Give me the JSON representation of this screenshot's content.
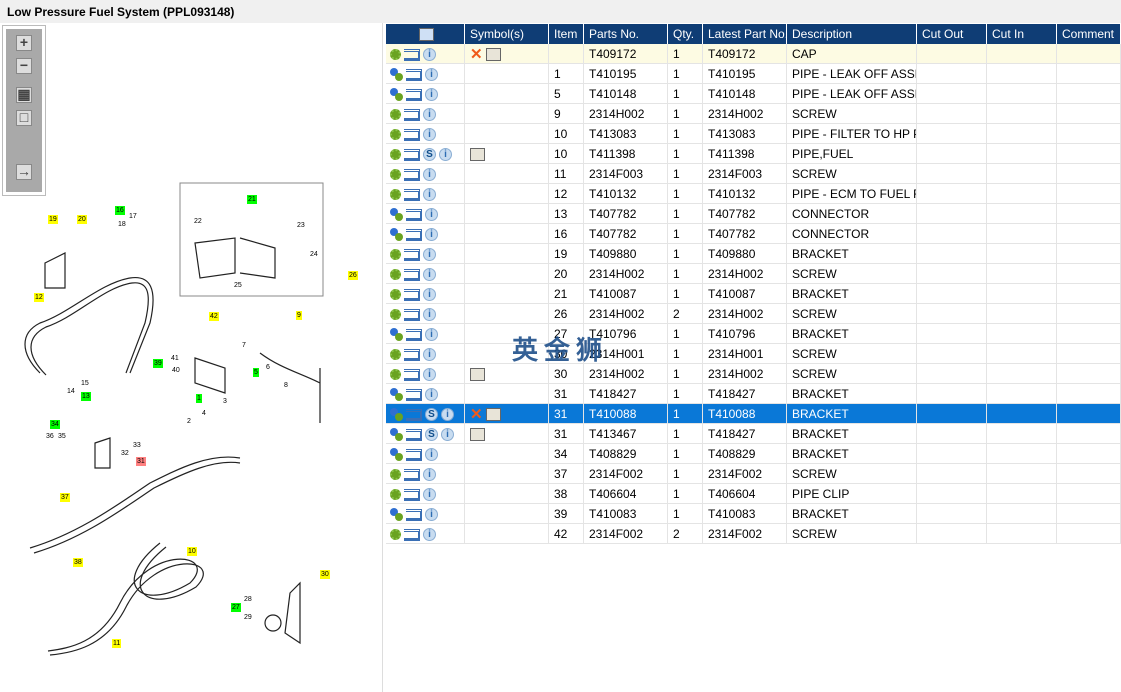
{
  "window_title": "Low Pressure Fuel System (PPL093148)",
  "toolbar": [
    "zoom-in",
    "zoom-out",
    "fit-all",
    "actual-size",
    "export"
  ],
  "watermark": "英金狮",
  "colors": {
    "header": "#0f3d75",
    "selected": "#0a78d7",
    "highlight": "#fdfbe3"
  },
  "columns": [
    "",
    "Symbol(s)",
    "Item",
    "Parts No.",
    "Qty.",
    "Latest Part No.",
    "Description",
    "Cut Out",
    "Cut In",
    "Comment"
  ],
  "rows": [
    {
      "gear": "single",
      "s": false,
      "sym": [
        "x",
        "book"
      ],
      "item": "",
      "part": "T409172",
      "qty": "1",
      "latest": "T409172",
      "desc": "CAP",
      "hl": true
    },
    {
      "gear": "multi",
      "s": false,
      "sym": [],
      "item": "1",
      "part": "T410195",
      "qty": "1",
      "latest": "T410195",
      "desc": "PIPE - LEAK OFF ASSEMBLY"
    },
    {
      "gear": "multi",
      "s": false,
      "sym": [],
      "item": "5",
      "part": "T410148",
      "qty": "1",
      "latest": "T410148",
      "desc": "PIPE - LEAK OFF ASSEMBLY"
    },
    {
      "gear": "single",
      "s": false,
      "sym": [],
      "item": "9",
      "part": "2314H002",
      "qty": "1",
      "latest": "2314H002",
      "desc": "SCREW"
    },
    {
      "gear": "single",
      "s": false,
      "sym": [],
      "item": "10",
      "part": "T413083",
      "qty": "1",
      "latest": "T413083",
      "desc": "PIPE - FILTER TO HP PUMP"
    },
    {
      "gear": "single",
      "s": true,
      "sym": [
        "book"
      ],
      "item": "10",
      "part": "T411398",
      "qty": "1",
      "latest": "T411398",
      "desc": "PIPE,FUEL"
    },
    {
      "gear": "single",
      "s": false,
      "sym": [],
      "item": "11",
      "part": "2314F003",
      "qty": "1",
      "latest": "2314F003",
      "desc": "SCREW"
    },
    {
      "gear": "single",
      "s": false,
      "sym": [],
      "item": "12",
      "part": "T410132",
      "qty": "1",
      "latest": "T410132",
      "desc": "PIPE - ECM TO FUEL FILTER"
    },
    {
      "gear": "multi",
      "s": false,
      "sym": [],
      "item": "13",
      "part": "T407782",
      "qty": "1",
      "latest": "T407782",
      "desc": "CONNECTOR"
    },
    {
      "gear": "multi",
      "s": false,
      "sym": [],
      "item": "16",
      "part": "T407782",
      "qty": "1",
      "latest": "T407782",
      "desc": "CONNECTOR"
    },
    {
      "gear": "single",
      "s": false,
      "sym": [],
      "item": "19",
      "part": "T409880",
      "qty": "1",
      "latest": "T409880",
      "desc": "BRACKET"
    },
    {
      "gear": "single",
      "s": false,
      "sym": [],
      "item": "20",
      "part": "2314H002",
      "qty": "1",
      "latest": "2314H002",
      "desc": "SCREW"
    },
    {
      "gear": "single",
      "s": false,
      "sym": [],
      "item": "21",
      "part": "T410087",
      "qty": "1",
      "latest": "T410087",
      "desc": "BRACKET"
    },
    {
      "gear": "single",
      "s": false,
      "sym": [],
      "item": "26",
      "part": "2314H002",
      "qty": "2",
      "latest": "2314H002",
      "desc": "SCREW"
    },
    {
      "gear": "multi",
      "s": false,
      "sym": [],
      "item": "27",
      "part": "T410796",
      "qty": "1",
      "latest": "T410796",
      "desc": "BRACKET"
    },
    {
      "gear": "single",
      "s": false,
      "sym": [],
      "item": "30",
      "part": "2314H001",
      "qty": "1",
      "latest": "2314H001",
      "desc": "SCREW"
    },
    {
      "gear": "single",
      "s": false,
      "sym": [
        "book"
      ],
      "item": "30",
      "part": "2314H002",
      "qty": "1",
      "latest": "2314H002",
      "desc": "SCREW"
    },
    {
      "gear": "multi",
      "s": false,
      "sym": [],
      "item": "31",
      "part": "T418427",
      "qty": "1",
      "latest": "T418427",
      "desc": "BRACKET"
    },
    {
      "gear": "multi",
      "s": true,
      "sym": [
        "x",
        "book"
      ],
      "item": "31",
      "part": "T410088",
      "qty": "1",
      "latest": "T410088",
      "desc": "BRACKET",
      "sel": true
    },
    {
      "gear": "multi",
      "s": true,
      "sym": [
        "book"
      ],
      "item": "31",
      "part": "T413467",
      "qty": "1",
      "latest": "T418427",
      "desc": "BRACKET"
    },
    {
      "gear": "multi",
      "s": false,
      "sym": [],
      "item": "34",
      "part": "T408829",
      "qty": "1",
      "latest": "T408829",
      "desc": "BRACKET"
    },
    {
      "gear": "single",
      "s": false,
      "sym": [],
      "item": "37",
      "part": "2314F002",
      "qty": "1",
      "latest": "2314F002",
      "desc": "SCREW"
    },
    {
      "gear": "single",
      "s": false,
      "sym": [],
      "item": "38",
      "part": "T406604",
      "qty": "1",
      "latest": "T406604",
      "desc": "PIPE CLIP"
    },
    {
      "gear": "multi",
      "s": false,
      "sym": [],
      "item": "39",
      "part": "T410083",
      "qty": "1",
      "latest": "T410083",
      "desc": "BRACKET"
    },
    {
      "gear": "single",
      "s": false,
      "sym": [],
      "item": "42",
      "part": "2314F002",
      "qty": "2",
      "latest": "2314F002",
      "desc": "SCREW"
    }
  ],
  "callouts": [
    {
      "t": "21",
      "c": "green"
    },
    {
      "t": "19",
      "c": "yellow"
    },
    {
      "t": "20",
      "c": "yellow"
    },
    {
      "t": "16",
      "c": "green"
    },
    {
      "t": "17",
      "c": ""
    },
    {
      "t": "18",
      "c": ""
    },
    {
      "t": "22",
      "c": ""
    },
    {
      "t": "23",
      "c": ""
    },
    {
      "t": "24",
      "c": ""
    },
    {
      "t": "25",
      "c": ""
    },
    {
      "t": "26",
      "c": "yellow"
    },
    {
      "t": "12",
      "c": "yellow"
    },
    {
      "t": "42",
      "c": "yellow"
    },
    {
      "t": "9",
      "c": "yellow"
    },
    {
      "t": "7",
      "c": ""
    },
    {
      "t": "6",
      "c": ""
    },
    {
      "t": "39",
      "c": "green"
    },
    {
      "t": "41",
      "c": ""
    },
    {
      "t": "40",
      "c": ""
    },
    {
      "t": "5",
      "c": "green"
    },
    {
      "t": "8",
      "c": ""
    },
    {
      "t": "15",
      "c": ""
    },
    {
      "t": "14",
      "c": ""
    },
    {
      "t": "13",
      "c": "green"
    },
    {
      "t": "1",
      "c": "green"
    },
    {
      "t": "3",
      "c": ""
    },
    {
      "t": "4",
      "c": ""
    },
    {
      "t": "2",
      "c": ""
    },
    {
      "t": "34",
      "c": "green"
    },
    {
      "t": "36",
      "c": ""
    },
    {
      "t": "35",
      "c": ""
    },
    {
      "t": "33",
      "c": ""
    },
    {
      "t": "32",
      "c": ""
    },
    {
      "t": "31",
      "c": "red"
    },
    {
      "t": "37",
      "c": "yellow"
    },
    {
      "t": "10",
      "c": "yellow"
    },
    {
      "t": "38",
      "c": "yellow"
    },
    {
      "t": "30",
      "c": "yellow"
    },
    {
      "t": "28",
      "c": ""
    },
    {
      "t": "27",
      "c": "green"
    },
    {
      "t": "29",
      "c": ""
    },
    {
      "t": "11",
      "c": "yellow"
    }
  ]
}
